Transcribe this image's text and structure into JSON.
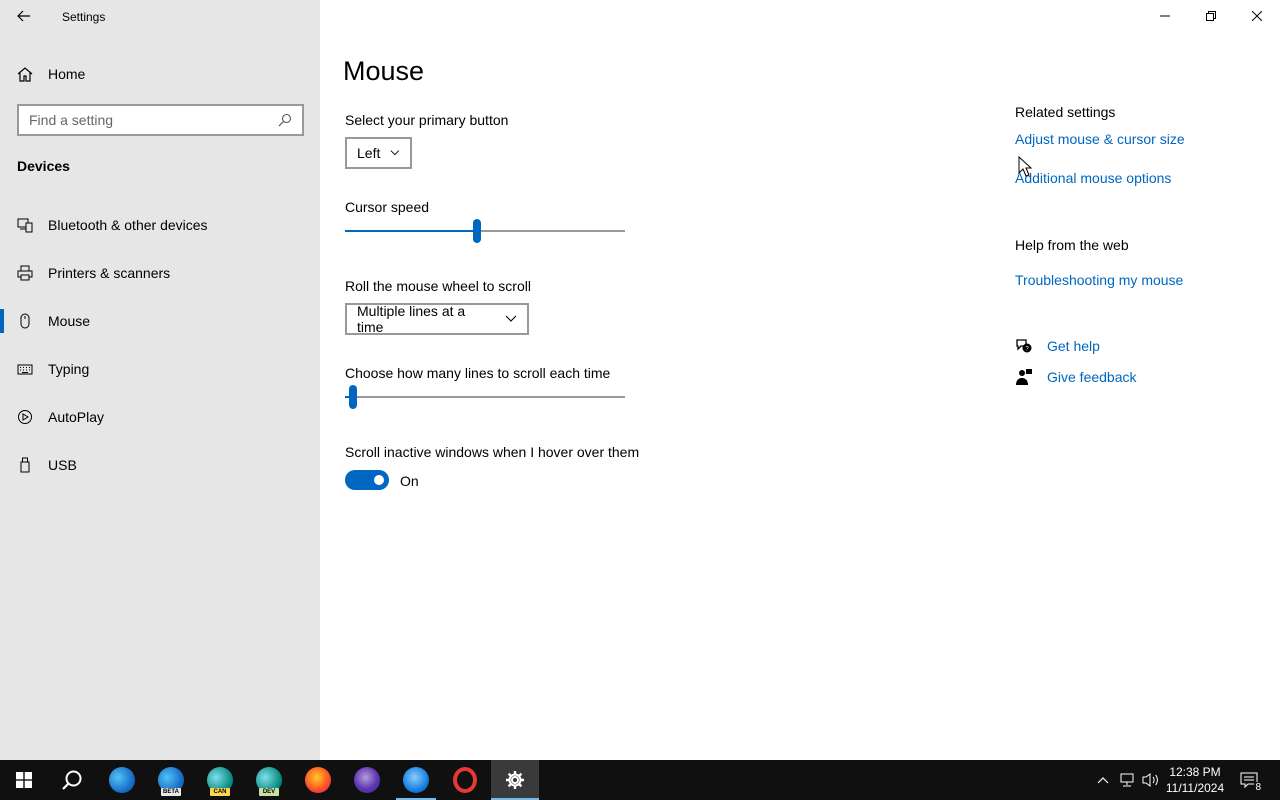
{
  "window": {
    "title": "Settings"
  },
  "sidebar": {
    "home_label": "Home",
    "search_placeholder": "Find a setting",
    "section_title": "Devices",
    "items": [
      {
        "label": "Bluetooth & other devices",
        "icon": "bluetooth-devices-icon"
      },
      {
        "label": "Printers & scanners",
        "icon": "printer-icon"
      },
      {
        "label": "Mouse",
        "icon": "mouse-icon",
        "selected": true
      },
      {
        "label": "Typing",
        "icon": "keyboard-icon"
      },
      {
        "label": "AutoPlay",
        "icon": "autoplay-icon"
      },
      {
        "label": "USB",
        "icon": "usb-icon"
      }
    ]
  },
  "main": {
    "title": "Mouse",
    "primary_button": {
      "label": "Select your primary button",
      "value": "Left"
    },
    "cursor_speed": {
      "label": "Cursor speed",
      "level": 0.47
    },
    "wheel_scroll": {
      "label": "Roll the mouse wheel to scroll",
      "value": "Multiple lines at a time"
    },
    "scroll_lines": {
      "label": "Choose how many lines to scroll each time",
      "level": 0.03
    },
    "inactive_scroll": {
      "label": "Scroll inactive windows when I hover over them",
      "state": "On",
      "on": true
    }
  },
  "related": {
    "heading": "Related settings",
    "links": [
      "Adjust mouse & cursor size",
      "Additional mouse options"
    ],
    "web_heading": "Help from the web",
    "web_links": [
      "Troubleshooting my mouse"
    ],
    "help": [
      {
        "label": "Get help",
        "icon": "get-help-icon"
      },
      {
        "label": "Give feedback",
        "icon": "feedback-icon"
      }
    ]
  },
  "taskbar": {
    "apps": [
      {
        "name": "edge",
        "color": "#1e88e5"
      },
      {
        "name": "edge-beta",
        "color": "#1e88e5",
        "badge": "BETA"
      },
      {
        "name": "edge-canary",
        "color": "#26a69a",
        "badge": "CAN"
      },
      {
        "name": "edge-dev",
        "color": "#26a69a",
        "badge": "DEV"
      },
      {
        "name": "firefox",
        "color": "#ff7139"
      },
      {
        "name": "firefox-nightly",
        "color": "#7e57c2"
      },
      {
        "name": "firefox-dev",
        "color": "#1e88e5"
      },
      {
        "name": "opera",
        "color": "#e53935"
      },
      {
        "name": "settings",
        "color": "#ffffff"
      }
    ],
    "time": "12:38 PM",
    "date": "11/11/2024",
    "notification_count": "8"
  },
  "colors": {
    "accent": "#0067c0",
    "sidebar_bg": "#e6e6e6",
    "taskbar_bg": "#101010"
  }
}
